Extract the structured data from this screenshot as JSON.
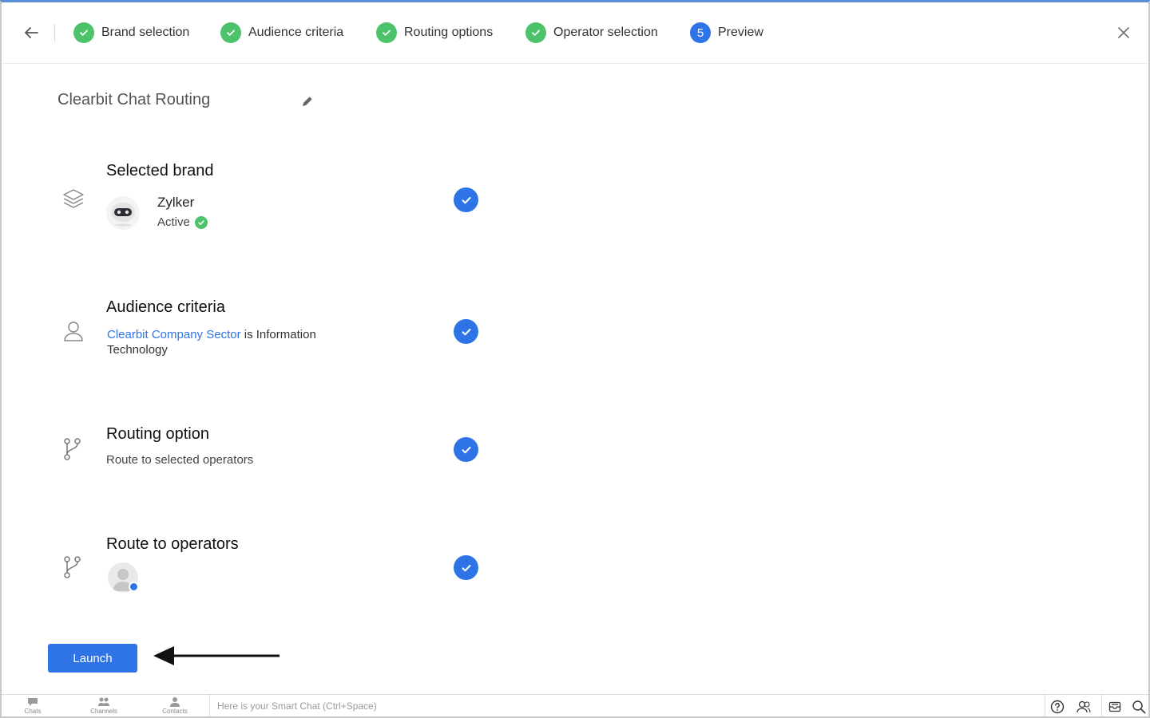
{
  "stepper": {
    "steps": [
      {
        "label": "Brand selection",
        "state": "done"
      },
      {
        "label": "Audience criteria",
        "state": "done"
      },
      {
        "label": "Routing options",
        "state": "done"
      },
      {
        "label": "Operator selection",
        "state": "done"
      },
      {
        "label": "Preview",
        "state": "current",
        "number": "5"
      }
    ]
  },
  "page": {
    "title": "Clearbit Chat Routing"
  },
  "brand_section": {
    "title": "Selected brand",
    "brand_name": "Zylker",
    "status": "Active"
  },
  "audience_section": {
    "title": "Audience criteria",
    "field": "Clearbit Company Sector",
    "operator": " is ",
    "value": "Information Technology"
  },
  "routing_section": {
    "title": "Routing option",
    "value": "Route to selected operators"
  },
  "operators_section": {
    "title": "Route to operators"
  },
  "actions": {
    "launch_label": "Launch"
  },
  "bottombar": {
    "nav": [
      {
        "label": "Chats",
        "icon": "chat-bubble-icon"
      },
      {
        "label": "Channels",
        "icon": "group-icon"
      },
      {
        "label": "Contacts",
        "icon": "person-icon"
      }
    ],
    "smart_chat_placeholder": "Here is your Smart Chat (Ctrl+Space)"
  },
  "colors": {
    "accent": "#2f74e6",
    "success": "#4cc26b",
    "link": "#2f74e6"
  }
}
